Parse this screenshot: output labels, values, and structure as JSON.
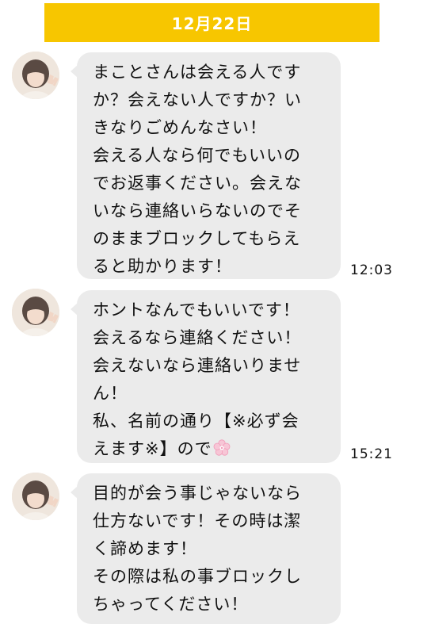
{
  "chat": {
    "date": "12月22日",
    "messages": [
      {
        "avatar": "user-avatar",
        "time": "12:03",
        "lines": [
          "まことさんは会える人です",
          "か？会えない人ですか？い",
          "きなりごめんなさい！",
          "会える人なら何でもいいの",
          "でお返事ください。会えな",
          "いなら連絡いらないのでそ",
          "のままブロックしてもらえ",
          "ると助かります！"
        ]
      },
      {
        "avatar": "user-avatar",
        "time": "15:21",
        "lines": [
          "ホントなんでもいいです！",
          "会えるなら連絡ください！",
          "会えないなら連絡いりませ",
          "ん！",
          "私、名前の通り【※必ず会",
          "えます※】ので"
        ],
        "trailing_icon": "cherry-blossom-icon"
      },
      {
        "avatar": "user-avatar",
        "lines": [
          "目的が会う事じゃないなら",
          "仕方ないです！その時は潔",
          "く諦めます！",
          "その際は私の事ブロックし",
          "ちゃってください！"
        ]
      }
    ]
  },
  "colors": {
    "date_banner": "#f7c600",
    "bubble": "#ebebeb",
    "background": "#ffffff",
    "flower": "#f4a9c0"
  }
}
